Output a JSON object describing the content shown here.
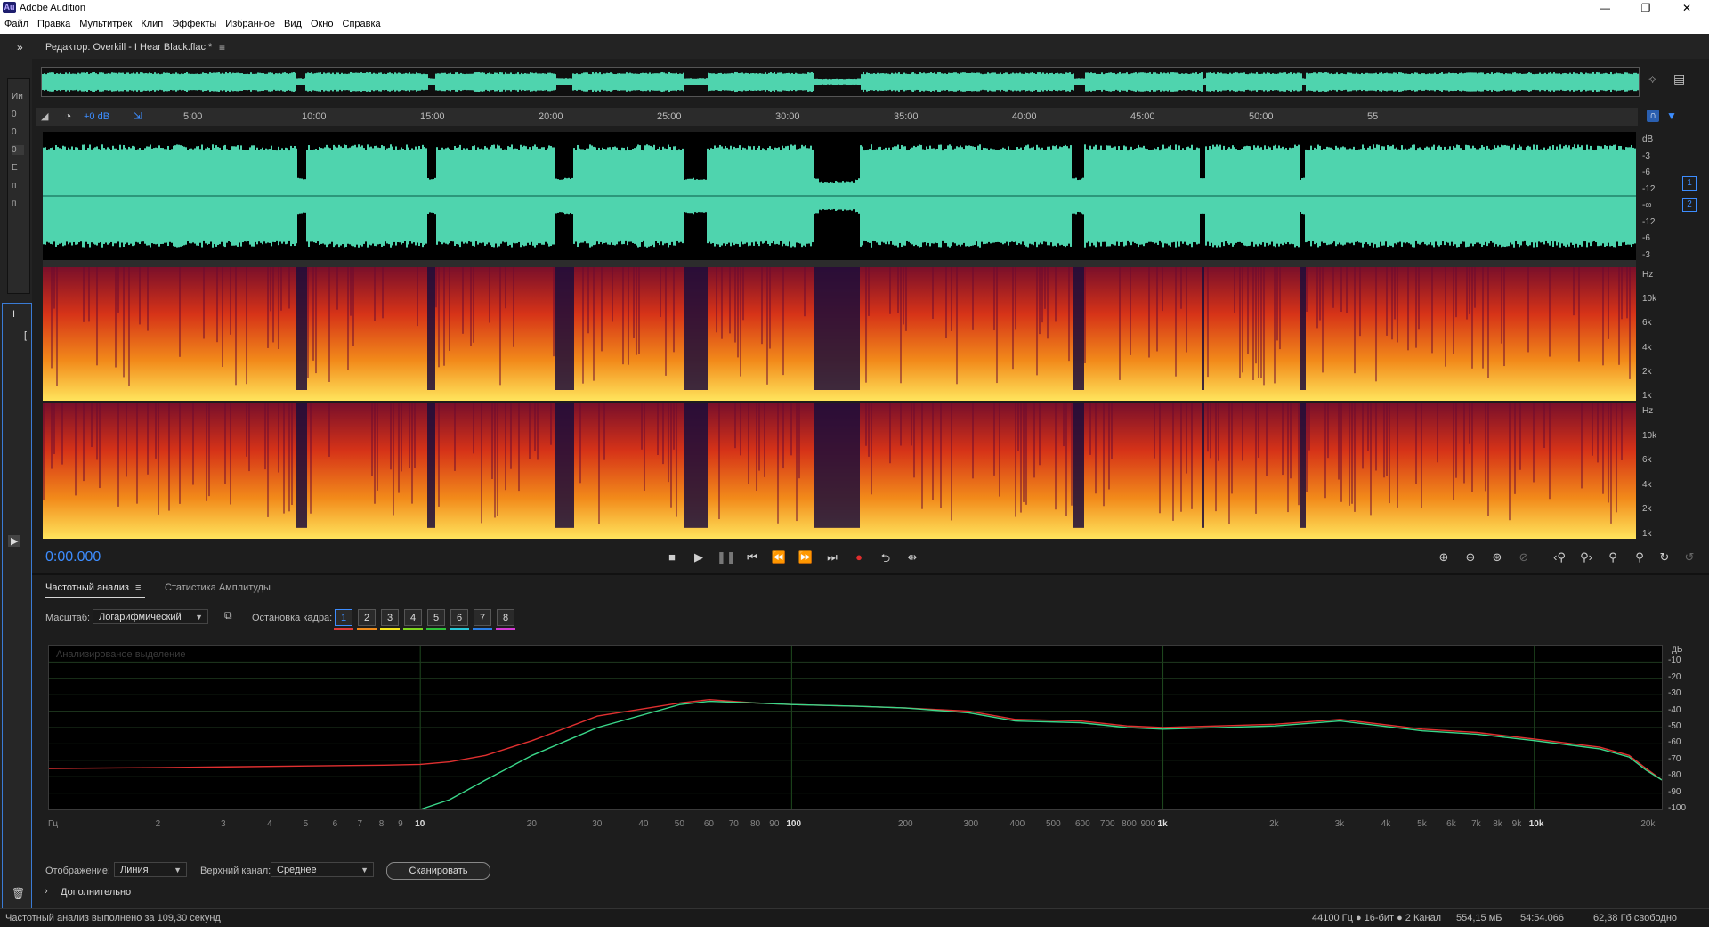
{
  "app": {
    "title": "Adobe Audition",
    "icon_label": "Au"
  },
  "window_controls": [
    "minimize-icon",
    "restore-icon",
    "close-icon"
  ],
  "menu": [
    "Файл",
    "Правка",
    "Мультитрек",
    "Клип",
    "Эффекты",
    "Избранное",
    "Вид",
    "Окно",
    "Справка"
  ],
  "left_strip": {
    "top_icon": "chevron-double-right-icon",
    "labels": [
      "Ии",
      "0",
      "0",
      "0",
      "E",
      "п",
      "п"
    ],
    "panel2_label": "I",
    "panel2_bracket": "[",
    "play_icon": "▶",
    "trash_icon": "trash-icon"
  },
  "editor": {
    "title": "Редактор: Overkill - I Hear Black.flac *",
    "menu_icon": "≡",
    "gain_label": "+0 dB",
    "timeline_ticks": [
      "5:00",
      "10:00",
      "15:00",
      "20:00",
      "25:00",
      "30:00",
      "35:00",
      "40:00",
      "45:00",
      "50:00",
      "55"
    ],
    "wave_scale": [
      "dB",
      "-3",
      "-6",
      "-12",
      "-∞",
      "-12",
      "-6",
      "-3"
    ],
    "channel_badges": [
      "1",
      "2"
    ],
    "spectral_scale": [
      "Hz",
      "10k",
      "6k",
      "4k",
      "2k",
      "1k"
    ],
    "timecode": "0:00.000",
    "colors": {
      "waveform": "#4fd4ae",
      "timecode": "#3d8dff"
    }
  },
  "transport": [
    "stop-icon",
    "play-icon",
    "pause-icon",
    "go-to-start-icon",
    "rewind-icon",
    "fast-forward-icon",
    "go-to-end-icon",
    "record-icon",
    "loop-icon",
    "skip-selection-icon"
  ],
  "zoom_tools": [
    "zoom-in-amplitude-icon",
    "zoom-out-amplitude-icon",
    "zoom-to-selection-icon",
    "zoom-out-full-icon",
    "zoom-in-left-icon",
    "zoom-in-right-icon",
    "zoom-in-time-icon",
    "zoom-out-time-icon",
    "zoom-full-icon",
    "reset-zoom-icon"
  ],
  "frequency_analysis": {
    "tabs": [
      {
        "label": "Частотный анализ",
        "active": true
      },
      {
        "label": "Статистика Амплитуды",
        "active": false
      }
    ],
    "tab_menu_icon": "≡",
    "scale_label": "Масштаб:",
    "scale_value": "Логарифмический",
    "freeze_label": "Остановка кадра:",
    "frame_buttons": [
      "1",
      "2",
      "3",
      "4",
      "5",
      "6",
      "7",
      "8"
    ],
    "frame_colors": [
      "#e23a3a",
      "#f08c1c",
      "#f5e61e",
      "#7fd61e",
      "#2ec23a",
      "#28c8d8",
      "#2a7fe6",
      "#d63ad6"
    ],
    "graph_caption": "Анализированое выделение",
    "display_label": "Отображение:",
    "display_value": "Линия",
    "channel_label": "Верхний канал:",
    "channel_value": "Среднее",
    "scan_button": "Сканировать",
    "advanced_label": "Дополнительно"
  },
  "chart_data": {
    "type": "line",
    "xscale": "log",
    "x_tick_labels": [
      "Гц",
      "2",
      "3",
      "4",
      "5",
      "6",
      "7",
      "8",
      "9",
      "10",
      "20",
      "30",
      "40",
      "50",
      "60",
      "70",
      "80",
      "90",
      "100",
      "200",
      "300",
      "400",
      "500",
      "600",
      "700",
      "800",
      "900",
      "1k",
      "2k",
      "3k",
      "4k",
      "5k",
      "6k",
      "7k",
      "8k",
      "9k",
      "10k",
      "20k"
    ],
    "x_tick_values": [
      1,
      2,
      3,
      4,
      5,
      6,
      7,
      8,
      9,
      10,
      20,
      30,
      40,
      50,
      60,
      70,
      80,
      90,
      100,
      200,
      300,
      400,
      500,
      600,
      700,
      800,
      900,
      1000,
      2000,
      3000,
      4000,
      5000,
      6000,
      7000,
      8000,
      9000,
      10000,
      20000
    ],
    "y_tick_labels": [
      "дБ",
      "-10",
      "-20",
      "-30",
      "-40",
      "-50",
      "-60",
      "-70",
      "-80",
      "-90",
      "-100"
    ],
    "y_tick_values": [
      0,
      -10,
      -20,
      -30,
      -40,
      -50,
      -60,
      -70,
      -80,
      -90,
      -100
    ],
    "xlim": [
      1,
      22050
    ],
    "ylim": [
      -100,
      0
    ],
    "series": [
      {
        "color": "#e03030",
        "x": [
          1,
          2,
          5,
          8,
          10,
          12,
          15,
          20,
          30,
          50,
          60,
          80,
          100,
          150,
          200,
          300,
          400,
          600,
          800,
          1000,
          2000,
          3000,
          5000,
          7000,
          10000,
          15000,
          18000,
          20000,
          22050
        ],
        "y": [
          -75,
          -74.5,
          -73.5,
          -73,
          -72.5,
          -71,
          -67,
          -58,
          -43,
          -35,
          -33,
          -35,
          -36,
          -37,
          -38,
          -40,
          -45,
          -46,
          -49,
          -50,
          -48,
          -45,
          -51,
          -53,
          -57,
          -62,
          -67,
          -75,
          -82
        ]
      },
      {
        "color": "#3ad88a",
        "x": [
          10,
          12,
          15,
          20,
          30,
          50,
          60,
          80,
          100,
          150,
          200,
          300,
          400,
          600,
          800,
          1000,
          2000,
          3000,
          5000,
          7000,
          10000,
          15000,
          18000,
          20000,
          22050
        ],
        "y": [
          -100,
          -94,
          -82,
          -67,
          -50,
          -36,
          -34,
          -35,
          -36,
          -37,
          -38,
          -41,
          -46,
          -47,
          -50,
          -51,
          -49,
          -46,
          -52,
          -54,
          -58,
          -63,
          -68,
          -76,
          -82
        ]
      }
    ]
  },
  "status": {
    "left": "Частотный анализ выполнено за 109,30 секунд",
    "format": "44100 Гц ● 16-бит ● 2 Канал",
    "size": "554,15 мБ",
    "duration": "54:54.066",
    "free": "62,38 Гб свободно"
  }
}
